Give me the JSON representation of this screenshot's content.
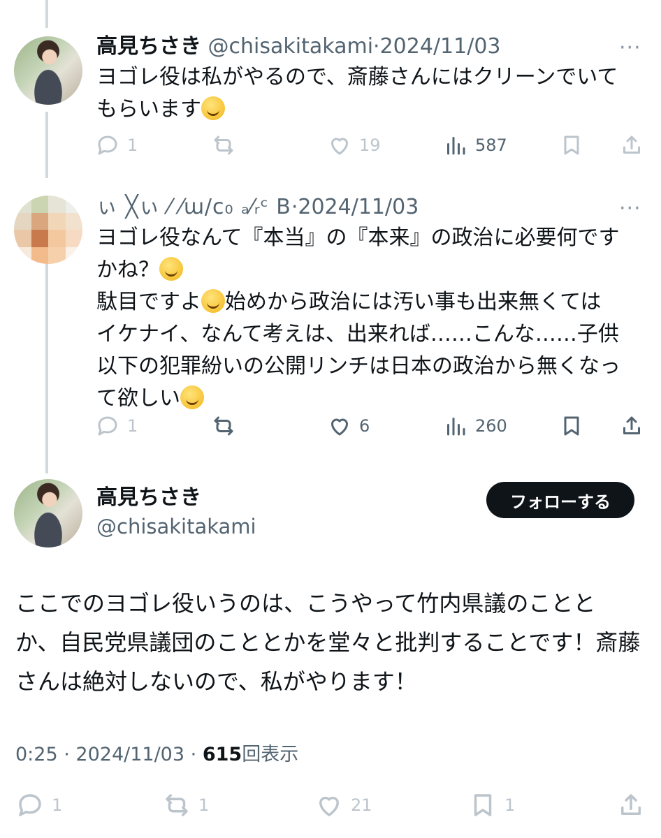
{
  "tweet1": {
    "name": "高見ちさき",
    "handle": "@chisakitakami",
    "sep": "·",
    "date": "2024/11/03",
    "more": "···",
    "text": "ヨゴレ役は私がやるので、斎藤さんにはクリーンでいて\nもらいます",
    "emoji": "rolling-on-floor-laughing-emoji",
    "replies": "1",
    "retweets": "",
    "likes": "19",
    "views": "587"
  },
  "tweet2": {
    "name_blurred": "ぃ  ╳ぃ ⁄ ⁄ɯ/ⅽ₀ ₐ⁄ᵣᶜ B",
    "sep": "·",
    "date": "2024/11/03",
    "more": "···",
    "text_line1": "ヨゴレ役なんて『本当』の『本来』の政治に必要何です\nかね？",
    "text_line2": "駄目ですよ",
    "text_line3": "始めから政治には汚い事も出来無くては\nイケナイ、なんて考えは、出来れば……こんな……子供\n以下の犯罪紛いの公開リンチは日本の政治から無くなっ\nて欲しい",
    "emoji1": "thinking-face-emoji",
    "emoji2": "face-holding-back-tears-emoji",
    "replies": "1",
    "retweets": "",
    "likes": "6",
    "views": "260"
  },
  "tweet3": {
    "name": "高見ちさき",
    "handle": "@chisakitakami",
    "follow_label": "フォローする",
    "text": "ここでのヨゴレ役いうのは、こうやって竹内県議のことと か、自民党県議団のこととかを堂々と批判することです！斎藤さんは絶対しないので、私がやります！",
    "time": "0:25",
    "date": "2024/11/03",
    "sep": "·",
    "views_count": "615",
    "views_label": "回表示",
    "replies": "1",
    "retweets": "1",
    "likes": "21",
    "bookmarks": "1"
  },
  "icons": [
    "reply-icon",
    "retweet-icon",
    "like-icon",
    "views-icon",
    "bookmark-icon",
    "share-icon"
  ],
  "colors": {
    "text": "#0f1419",
    "secondary": "#536471",
    "faint": "#bcc4cc",
    "follow_bg": "#0f1419",
    "thread_line": "#cfd9de"
  }
}
